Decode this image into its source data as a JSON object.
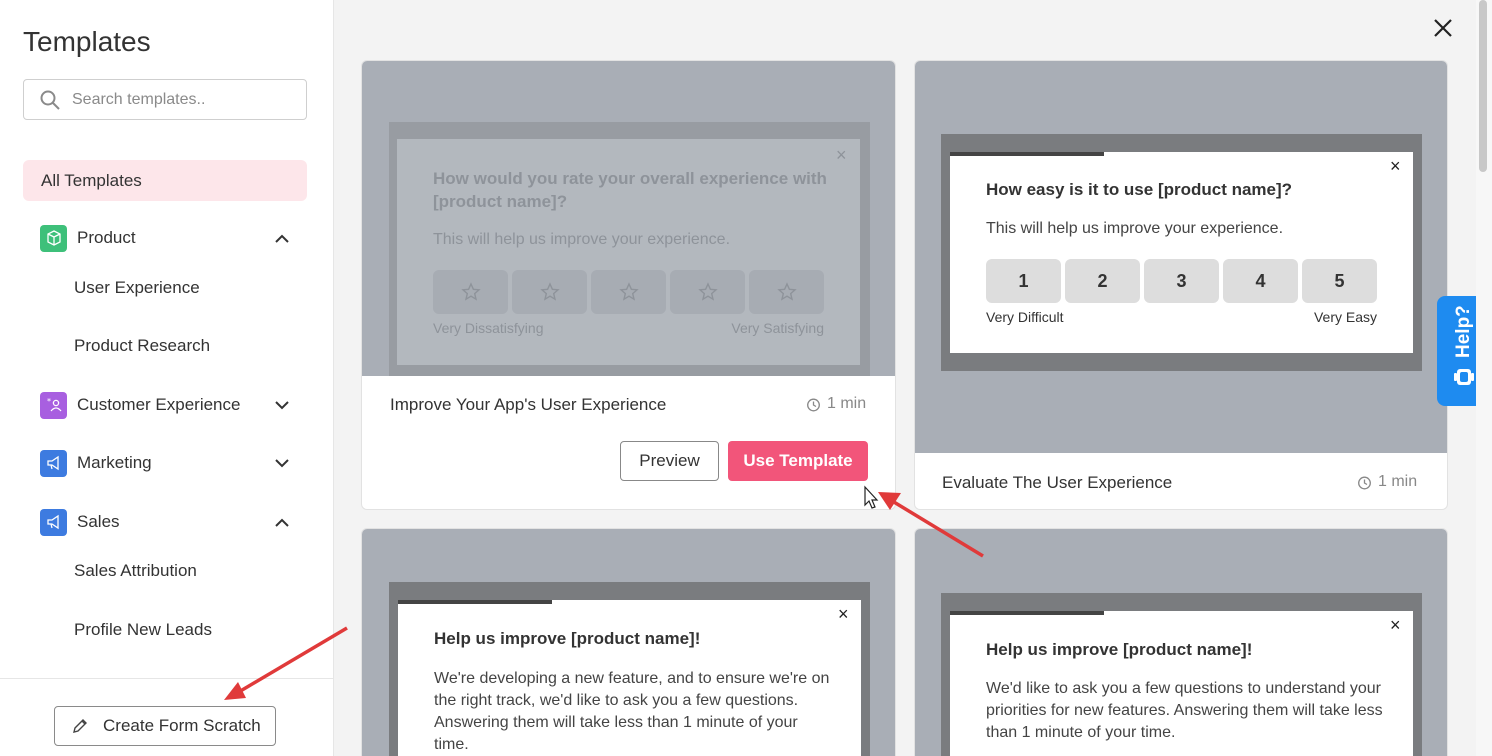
{
  "sidebar": {
    "title": "Templates",
    "search": {
      "placeholder": "Search templates.."
    },
    "all_templates": "All Templates",
    "categories": [
      {
        "label": "Product",
        "color": "#3ec07a",
        "expanded": true,
        "items": [
          "User Experience",
          "Product Research"
        ]
      },
      {
        "label": "Customer Experience",
        "color": "#a85fe0",
        "expanded": false,
        "items": []
      },
      {
        "label": "Marketing",
        "color": "#3d7be0",
        "expanded": false,
        "items": []
      },
      {
        "label": "Sales",
        "color": "#3d7be0",
        "expanded": true,
        "items": [
          "Sales Attribution",
          "Profile New Leads"
        ]
      }
    ],
    "create_button": "Create Form Scratch"
  },
  "cards": [
    {
      "title": "Improve Your App's User Experience",
      "time": "1 min",
      "question": "How would you rate your overall experience with [product name]?",
      "description": "This will help us improve your experience.",
      "low_label": "Very Dissatisfying",
      "high_label": "Very Satisfying",
      "close": "×",
      "preview_button": "Preview",
      "use_button": "Use Template"
    },
    {
      "title": "Evaluate The User Experience",
      "time": "1 min",
      "question": "How easy is it to use [product name]?",
      "description": "This will help us improve your experience.",
      "scale": [
        "1",
        "2",
        "3",
        "4",
        "5"
      ],
      "low_label": "Very Difficult",
      "high_label": "Very Easy",
      "close": "×"
    },
    {
      "question": "Help us improve [product name]!",
      "description": "We're developing a new feature, and to ensure we're on the right track, we'd like to ask you a few questions. Answering them will take less than 1 minute of your time.",
      "close": "×"
    },
    {
      "question": "Help us improve [product name]!",
      "description": "We'd like to ask you a few questions to understand your priorities for new features. Answering them will take less than 1 minute of your time.",
      "close": "×"
    }
  ],
  "help": {
    "label": "Help?"
  },
  "colors": {
    "accent": "#f2557a",
    "selected_bg": "#fde6ea",
    "help_blue": "#1e8bf0",
    "arrow_red": "#e03a3a"
  }
}
